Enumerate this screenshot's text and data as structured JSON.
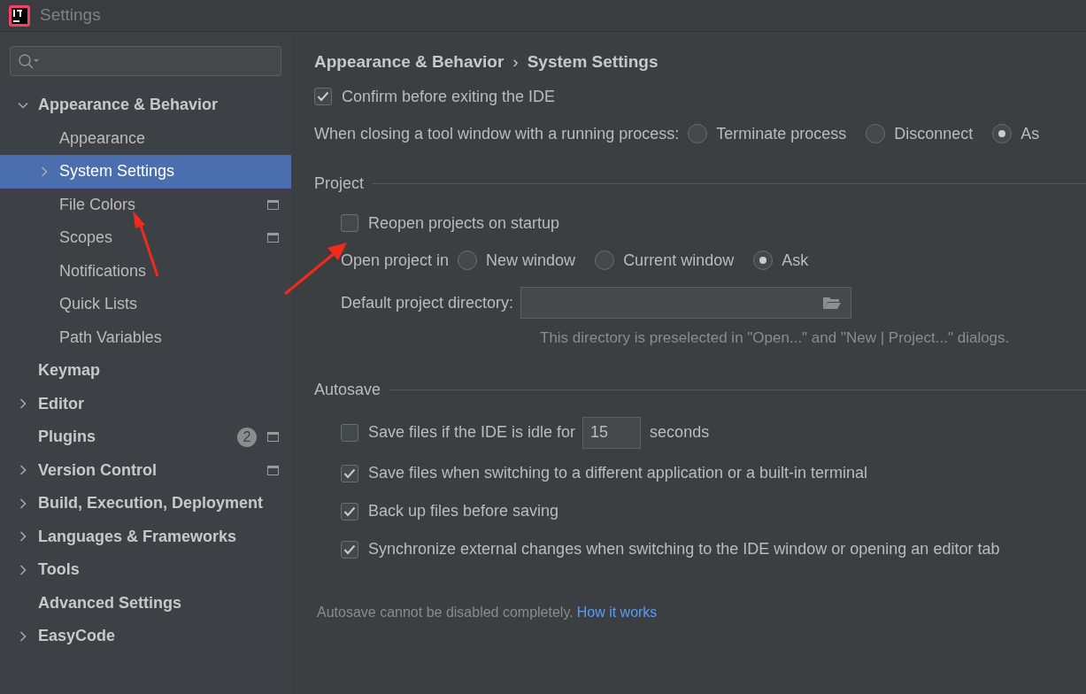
{
  "window": {
    "title": "Settings"
  },
  "sidebar": {
    "items": [
      {
        "kind": "group",
        "label": "Appearance & Behavior",
        "expanded": true,
        "selected": false,
        "project_icon": false,
        "children": [
          {
            "kind": "leaf",
            "label": "Appearance",
            "selected": false,
            "project_icon": false
          },
          {
            "kind": "group",
            "label": "System Settings",
            "expanded": false,
            "selected": true,
            "project_icon": false
          },
          {
            "kind": "leaf",
            "label": "File Colors",
            "selected": false,
            "project_icon": true
          },
          {
            "kind": "leaf",
            "label": "Scopes",
            "selected": false,
            "project_icon": true
          },
          {
            "kind": "leaf",
            "label": "Notifications",
            "selected": false,
            "project_icon": false
          },
          {
            "kind": "leaf",
            "label": "Quick Lists",
            "selected": false,
            "project_icon": false
          },
          {
            "kind": "leaf",
            "label": "Path Variables",
            "selected": false,
            "project_icon": false
          }
        ]
      },
      {
        "kind": "leaf",
        "label": "Keymap",
        "selected": false,
        "project_icon": false
      },
      {
        "kind": "group",
        "label": "Editor",
        "expanded": false,
        "selected": false,
        "project_icon": false
      },
      {
        "kind": "leaf",
        "label": "Plugins",
        "selected": false,
        "project_icon": true,
        "badge": "2"
      },
      {
        "kind": "group",
        "label": "Version Control",
        "expanded": false,
        "selected": false,
        "project_icon": true
      },
      {
        "kind": "group",
        "label": "Build, Execution, Deployment",
        "expanded": false,
        "selected": false,
        "project_icon": false
      },
      {
        "kind": "group",
        "label": "Languages & Frameworks",
        "expanded": false,
        "selected": false,
        "project_icon": false
      },
      {
        "kind": "group",
        "label": "Tools",
        "expanded": false,
        "selected": false,
        "project_icon": false
      },
      {
        "kind": "leaf",
        "label": "Advanced Settings",
        "selected": false,
        "project_icon": false
      },
      {
        "kind": "group",
        "label": "EasyCode",
        "expanded": false,
        "selected": false,
        "project_icon": false
      }
    ]
  },
  "breadcrumb": {
    "items": [
      "Appearance & Behavior",
      "System Settings"
    ],
    "separator": "›"
  },
  "general": {
    "confirm_exit": {
      "label": "Confirm before exiting the IDE",
      "checked": true
    },
    "close_tool_window": {
      "label": "When closing a tool window with a running process:",
      "options": [
        {
          "label": "Terminate process",
          "selected": false
        },
        {
          "label": "Disconnect",
          "selected": false
        },
        {
          "label": "As",
          "selected": true
        }
      ]
    }
  },
  "project": {
    "title": "Project",
    "reopen": {
      "label": "Reopen projects on startup",
      "checked": false
    },
    "open_in": {
      "label": "Open project in",
      "options": [
        {
          "label": "New window",
          "selected": false
        },
        {
          "label": "Current window",
          "selected": false
        },
        {
          "label": "Ask",
          "selected": true
        }
      ]
    },
    "directory": {
      "label": "Default project directory:",
      "hint": "This directory is preselected in \"Open...\" and \"New | Project...\" dialogs."
    }
  },
  "autosave": {
    "title": "Autosave",
    "options": [
      {
        "kind": "idle",
        "label": "Save files if the IDE is idle for",
        "checked": false,
        "value": "15",
        "unit": "seconds"
      },
      {
        "kind": "plain",
        "label": "Save files when switching to a different application or a built-in terminal",
        "checked": true
      },
      {
        "kind": "plain",
        "label": "Back up files before saving",
        "checked": true
      },
      {
        "kind": "plain",
        "label": "Synchronize external changes when switching to the IDE window or opening an editor tab",
        "checked": true
      }
    ],
    "note": "Autosave cannot be disabled completely.",
    "link": "How it works"
  }
}
